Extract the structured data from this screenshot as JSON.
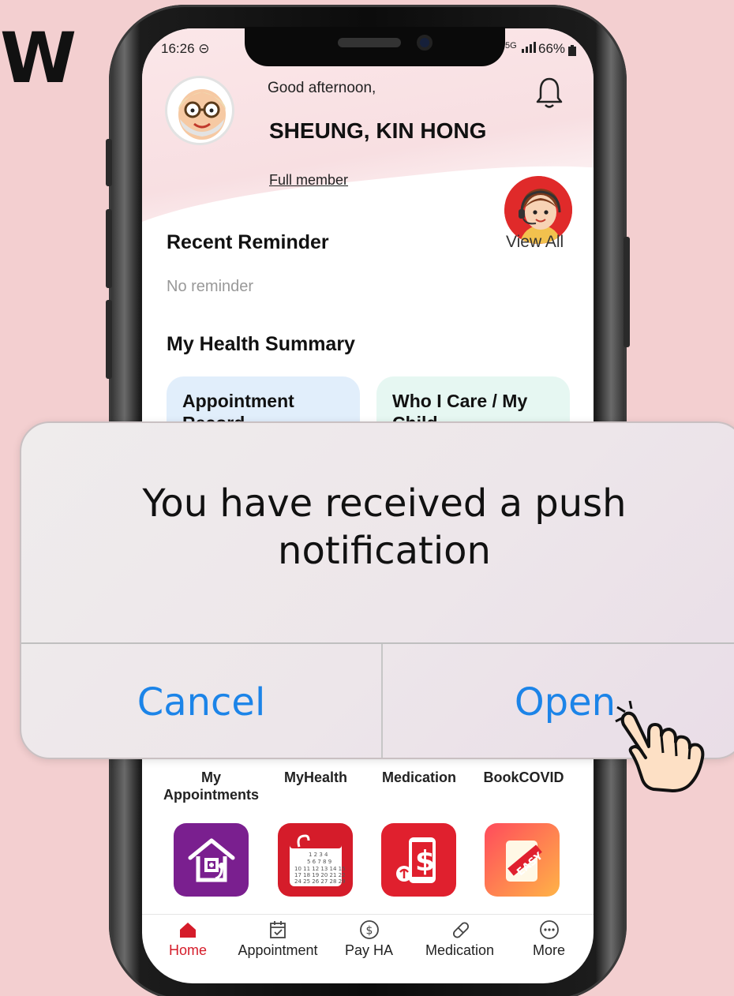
{
  "edge_text": "W",
  "status_bar": {
    "time": "16:26 ⊝",
    "network": "5G",
    "battery": "66%"
  },
  "header": {
    "greeting": "Good afternoon,",
    "name": "SHEUNG, KIN HONG",
    "membership": "Full member"
  },
  "reminder": {
    "title": "Recent Reminder",
    "view_all": "View All",
    "empty": "No reminder"
  },
  "summary": {
    "title": "My Health Summary",
    "cards": [
      "Appointment Record",
      "Who I Care / My Child"
    ]
  },
  "services": [
    "My Appointments",
    "MyHealth",
    "Medication",
    "BookCOVID"
  ],
  "tabs": [
    "Home",
    "Appointment",
    "Pay HA",
    "Medication",
    "More"
  ],
  "dialog": {
    "message": "You have received a push notification",
    "cancel": "Cancel",
    "open": "Open"
  },
  "colors": {
    "accent": "#d51c2a",
    "ios_blue": "#1c84e8",
    "background": "#f3cfd0"
  }
}
